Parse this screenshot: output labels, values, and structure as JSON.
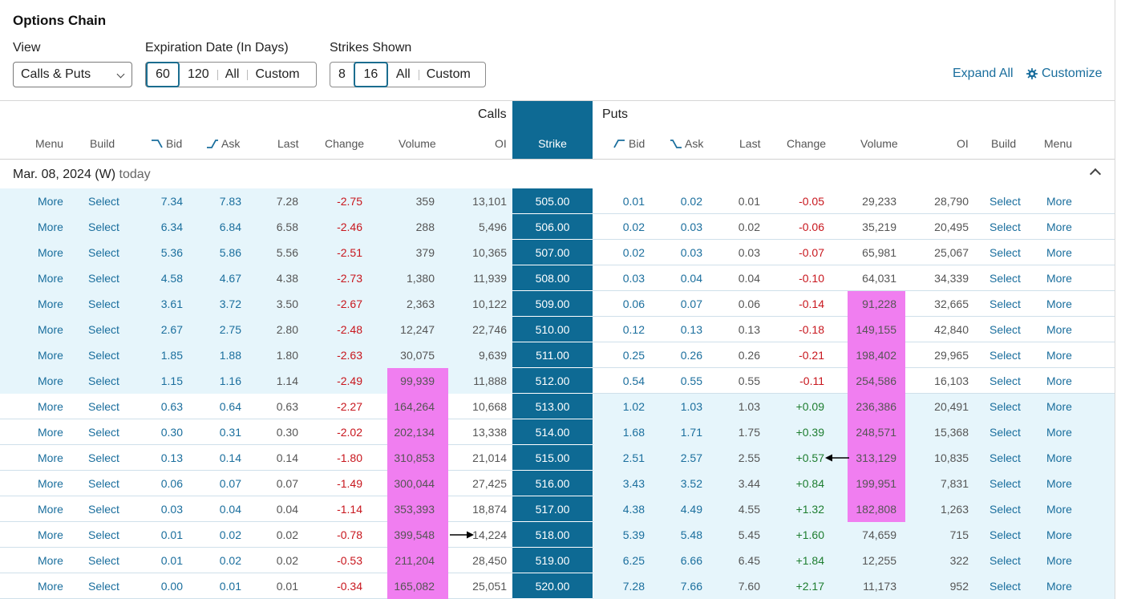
{
  "title": "Options Chain",
  "controls": {
    "view_label": "View",
    "view_value": "Calls & Puts",
    "exp_label": "Expiration Date (In Days)",
    "exp_options": [
      "60",
      "120",
      "All",
      "Custom"
    ],
    "strikes_label": "Strikes Shown",
    "strikes_options": [
      "8",
      "16",
      "All",
      "Custom"
    ],
    "expand_all": "Expand All",
    "customize": "Customize"
  },
  "groups": {
    "calls": "Calls",
    "puts": "Puts"
  },
  "columns": {
    "calls": [
      "Menu",
      "Build",
      "Bid",
      "Ask",
      "Last",
      "Change",
      "Volume",
      "OI"
    ],
    "strike": "Strike",
    "puts": [
      "Bid",
      "Ask",
      "Last",
      "Change",
      "Volume",
      "OI",
      "Build",
      "Menu"
    ]
  },
  "expiry": {
    "date": "Mar. 08, 2024 (W)",
    "note": "today"
  },
  "row_links": {
    "more": "More",
    "select": "Select"
  },
  "rows": [
    {
      "strike": "505.00",
      "c": [
        "7.34",
        "7.83",
        "7.28",
        "-2.75",
        "359",
        "13,101"
      ],
      "p": [
        "0.01",
        "0.02",
        "0.01",
        "-0.05",
        "29,233",
        "28,790"
      ]
    },
    {
      "strike": "506.00",
      "c": [
        "6.34",
        "6.84",
        "6.58",
        "-2.46",
        "288",
        "5,496"
      ],
      "p": [
        "0.02",
        "0.03",
        "0.02",
        "-0.06",
        "35,219",
        "20,495"
      ]
    },
    {
      "strike": "507.00",
      "c": [
        "5.36",
        "5.86",
        "5.56",
        "-2.51",
        "379",
        "10,365"
      ],
      "p": [
        "0.02",
        "0.03",
        "0.03",
        "-0.07",
        "65,981",
        "25,067"
      ]
    },
    {
      "strike": "508.00",
      "c": [
        "4.58",
        "4.67",
        "4.38",
        "-2.73",
        "1,380",
        "11,939"
      ],
      "p": [
        "0.03",
        "0.04",
        "0.04",
        "-0.10",
        "64,031",
        "34,339"
      ]
    },
    {
      "strike": "509.00",
      "c": [
        "3.61",
        "3.72",
        "3.50",
        "-2.67",
        "2,363",
        "10,122"
      ],
      "p": [
        "0.06",
        "0.07",
        "0.06",
        "-0.14",
        "91,228",
        "32,665"
      ]
    },
    {
      "strike": "510.00",
      "c": [
        "2.67",
        "2.75",
        "2.80",
        "-2.48",
        "12,247",
        "22,746"
      ],
      "p": [
        "0.12",
        "0.13",
        "0.13",
        "-0.18",
        "149,155",
        "42,840"
      ]
    },
    {
      "strike": "511.00",
      "c": [
        "1.85",
        "1.88",
        "1.80",
        "-2.63",
        "30,075",
        "9,639"
      ],
      "p": [
        "0.25",
        "0.26",
        "0.26",
        "-0.21",
        "198,402",
        "29,965"
      ]
    },
    {
      "strike": "512.00",
      "c": [
        "1.15",
        "1.16",
        "1.14",
        "-2.49",
        "99,939",
        "11,888"
      ],
      "p": [
        "0.54",
        "0.55",
        "0.55",
        "-0.11",
        "254,586",
        "16,103"
      ]
    },
    {
      "strike": "513.00",
      "c": [
        "0.63",
        "0.64",
        "0.63",
        "-2.27",
        "164,264",
        "10,668"
      ],
      "p": [
        "1.02",
        "1.03",
        "1.03",
        "+0.09",
        "236,386",
        "20,491"
      ]
    },
    {
      "strike": "514.00",
      "c": [
        "0.30",
        "0.31",
        "0.30",
        "-2.02",
        "202,134",
        "13,338"
      ],
      "p": [
        "1.68",
        "1.71",
        "1.75",
        "+0.39",
        "248,571",
        "15,368"
      ]
    },
    {
      "strike": "515.00",
      "c": [
        "0.13",
        "0.14",
        "0.14",
        "-1.80",
        "310,853",
        "21,014"
      ],
      "p": [
        "2.51",
        "2.57",
        "2.55",
        "+0.57",
        "313,129",
        "10,835"
      ]
    },
    {
      "strike": "516.00",
      "c": [
        "0.06",
        "0.07",
        "0.07",
        "-1.49",
        "300,044",
        "27,425"
      ],
      "p": [
        "3.43",
        "3.52",
        "3.44",
        "+0.84",
        "199,951",
        "7,831"
      ]
    },
    {
      "strike": "517.00",
      "c": [
        "0.03",
        "0.04",
        "0.04",
        "-1.14",
        "353,393",
        "18,874"
      ],
      "p": [
        "4.38",
        "4.49",
        "4.55",
        "+1.32",
        "182,808",
        "1,263"
      ]
    },
    {
      "strike": "518.00",
      "c": [
        "0.01",
        "0.02",
        "0.02",
        "-0.78",
        "399,548",
        "14,224"
      ],
      "p": [
        "5.39",
        "5.48",
        "5.45",
        "+1.60",
        "74,659",
        "715"
      ]
    },
    {
      "strike": "519.00",
      "c": [
        "0.01",
        "0.02",
        "0.02",
        "-0.53",
        "211,204",
        "28,450"
      ],
      "p": [
        "6.25",
        "6.66",
        "6.45",
        "+1.84",
        "12,255",
        "322"
      ]
    },
    {
      "strike": "520.00",
      "c": [
        "0.00",
        "0.01",
        "0.01",
        "-0.34",
        "165,082",
        "25,051"
      ],
      "p": [
        "7.28",
        "7.66",
        "7.60",
        "+2.17",
        "11,173",
        "952"
      ]
    }
  ],
  "colors": {
    "strike_bg": "#0e6a94",
    "itm_bg": "#e6f5fb",
    "highlight": "#f07ef0",
    "link": "#1a6e9d",
    "negative": "#c8161d",
    "positive": "#1d7d2f"
  }
}
